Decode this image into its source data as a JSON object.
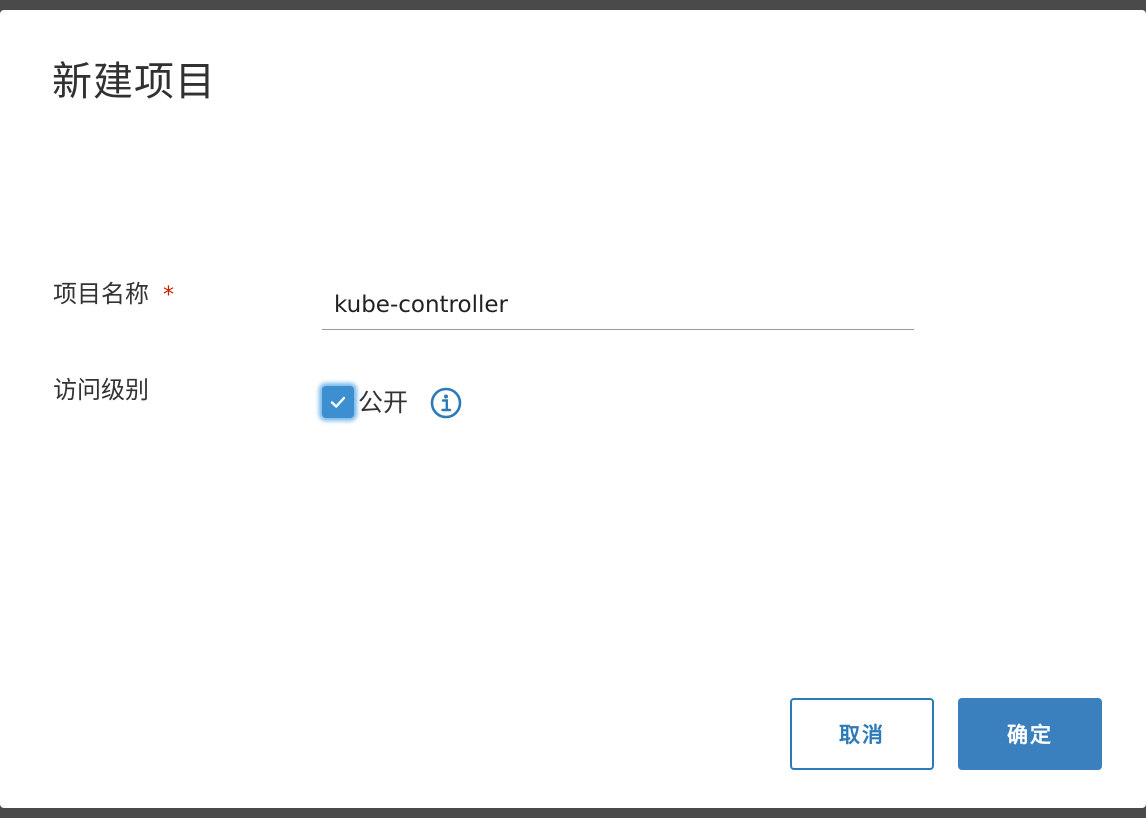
{
  "dialog": {
    "title": "新建项目"
  },
  "form": {
    "project_name": {
      "label": "项目名称",
      "required_mark": "*",
      "value": "kube-controller"
    },
    "access_level": {
      "label": "访问级别",
      "checkbox_label": "公开",
      "checked": true,
      "info_icon": "info-circle-icon"
    }
  },
  "buttons": {
    "cancel_label": "取消",
    "confirm_label": "确定"
  },
  "colors": {
    "primary": "#3a7fbe",
    "required": "#c92100",
    "checkbox": "#3d8fd1"
  }
}
